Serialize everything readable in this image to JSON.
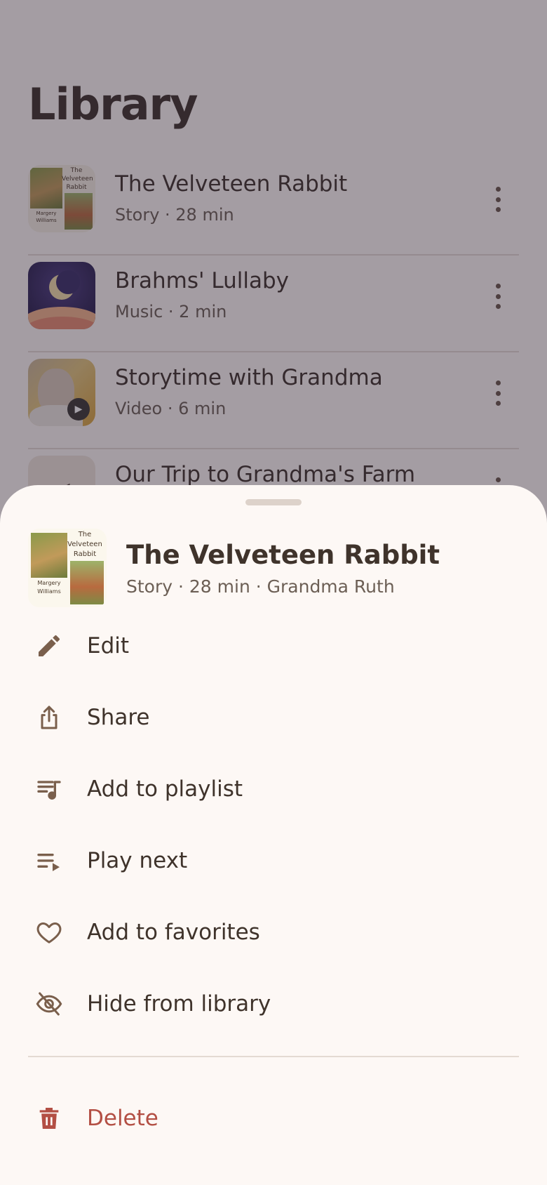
{
  "library": {
    "title": "Library",
    "items": [
      {
        "title": "The Velveteen Rabbit",
        "subtitle": "Story · 28 min",
        "thumb": "book-cover"
      },
      {
        "title": "Brahms' Lullaby",
        "subtitle": "Music · 2 min",
        "thumb": "moon-art"
      },
      {
        "title": "Storytime with Grandma",
        "subtitle": "Video · 6 min",
        "thumb": "video-frame"
      },
      {
        "title": "Our Trip to Grandma's Farm",
        "subtitle": "",
        "thumb": "audio-speaker"
      }
    ],
    "book_cover_title": "The Velveteen Rabbit",
    "book_cover_author": "Margery Williams"
  },
  "sheet": {
    "title": "The Velveteen Rabbit",
    "subtitle": "Story · 28 min · Grandma Ruth",
    "menu": [
      {
        "label": "Edit",
        "icon": "pencil-icon"
      },
      {
        "label": "Share",
        "icon": "share-icon"
      },
      {
        "label": "Add to playlist",
        "icon": "playlist-add-icon"
      },
      {
        "label": "Play next",
        "icon": "play-next-icon"
      },
      {
        "label": "Add to favorites",
        "icon": "heart-icon"
      },
      {
        "label": "Hide from library",
        "icon": "eye-off-icon"
      }
    ],
    "delete_label": "Delete"
  },
  "colors": {
    "background": "#fdf8f5",
    "text": "#3f332b",
    "icon": "#7a5f4c",
    "danger": "#b34f44"
  }
}
